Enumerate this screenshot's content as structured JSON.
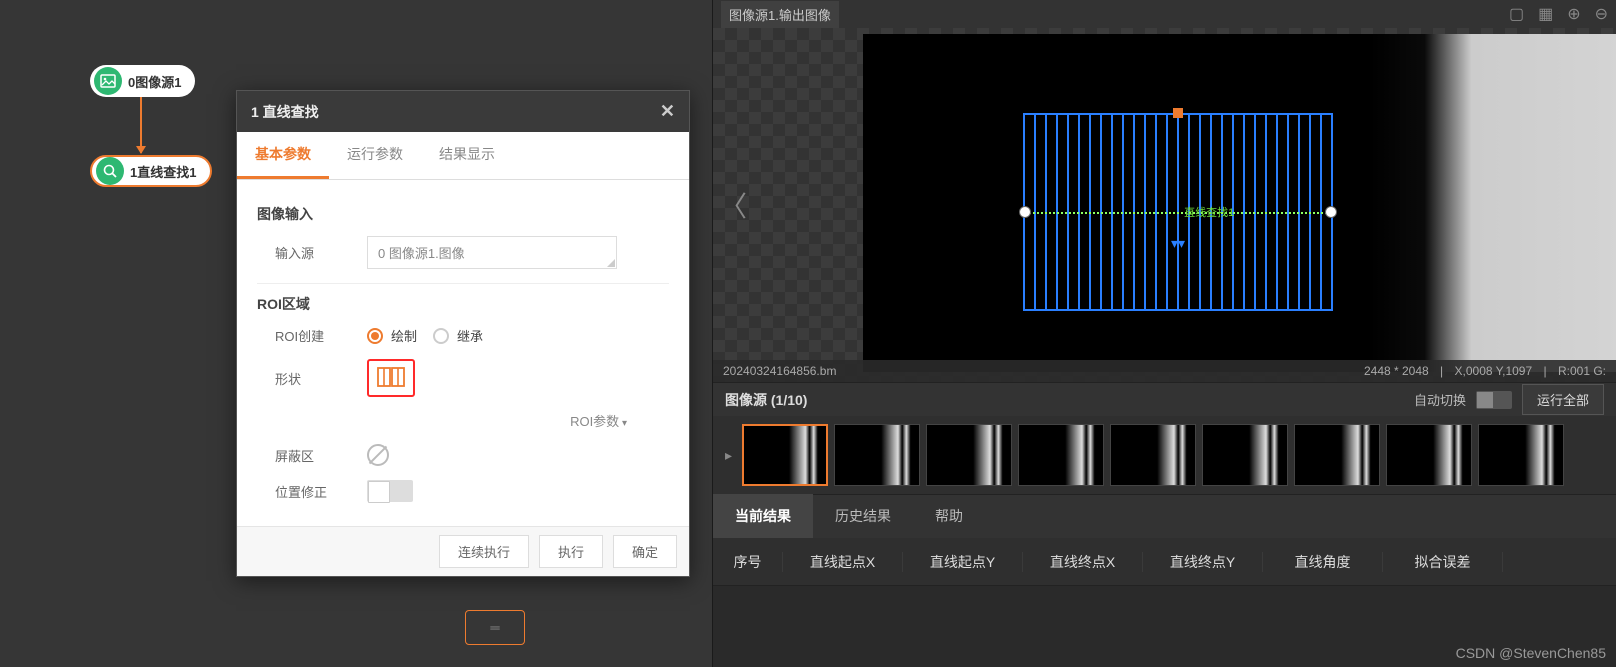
{
  "flow": {
    "node1_label": "0图像源1",
    "node2_label": "1直线查找1"
  },
  "dialog": {
    "title": "1 直线查找",
    "tabs": [
      "基本参数",
      "运行参数",
      "结果显示"
    ],
    "section_image_input": "图像输入",
    "label_input_source": "输入源",
    "input_source_value": "0 图像源1.图像",
    "section_roi": "ROI区域",
    "label_roi_create": "ROI创建",
    "radio_draw": "绘制",
    "radio_inherit": "继承",
    "label_shape": "形状",
    "roi_params_label": "ROI参数",
    "label_mask": "屏蔽区",
    "label_pos_fix": "位置修正",
    "btn_cont_exec": "连续执行",
    "btn_exec": "执行",
    "btn_ok": "确定"
  },
  "viewer": {
    "source_label": "图像源1.输出图像",
    "filename": "20240324164856.bm",
    "resolution": "2448 * 2048",
    "coord": "X,0008  Y,1097",
    "rgb": "R:001  G:",
    "fit_label": "直线查找1"
  },
  "thumbs": {
    "header": "图像源 (1/10)",
    "auto_switch": "自动切换",
    "run_all": "运行全部"
  },
  "results": {
    "tabs": [
      "当前结果",
      "历史结果",
      "帮助"
    ],
    "columns": [
      "序号",
      "直线起点X",
      "直线起点Y",
      "直线终点X",
      "直线终点Y",
      "直线角度",
      "拟合误差"
    ]
  },
  "watermark": "CSDN @StevenChen85"
}
